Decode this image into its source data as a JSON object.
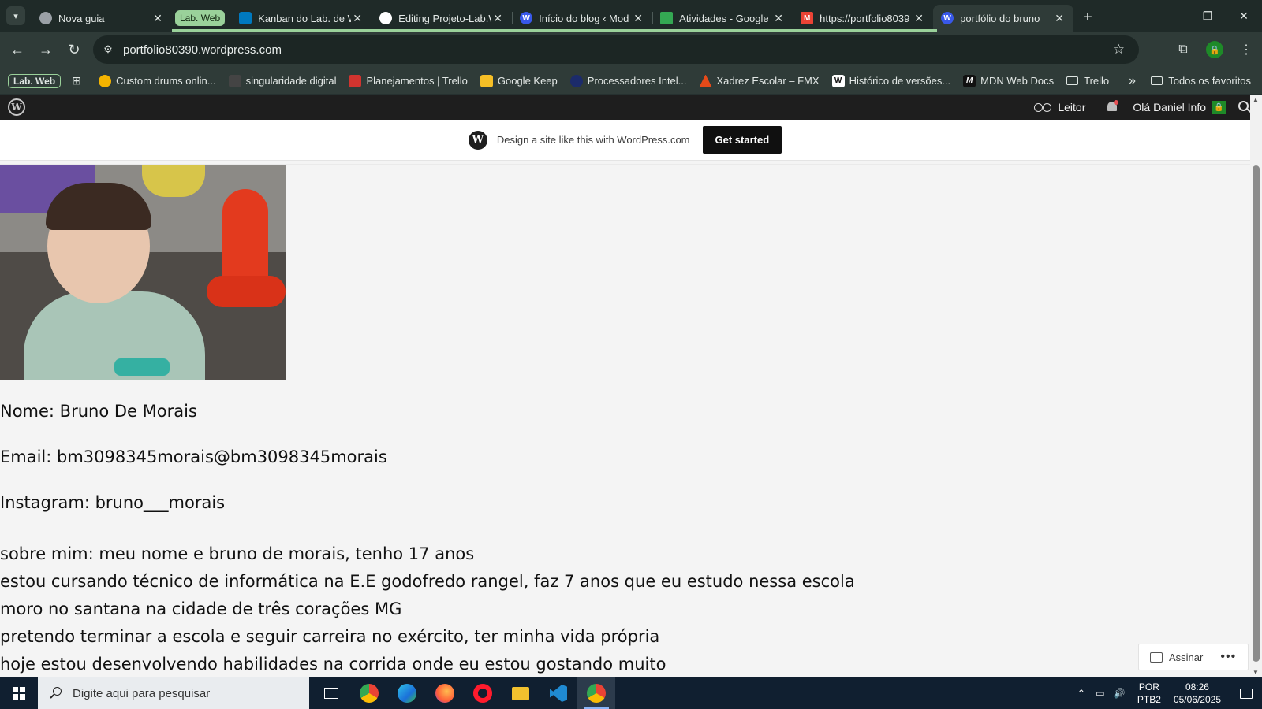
{
  "browser": {
    "tabs": [
      {
        "title": "Nova guia",
        "icon": "chrome-icon",
        "color": "#9aa0a6"
      },
      {
        "title": "Kanban do Lab. de W",
        "icon": "trello-icon",
        "color": "#0079bf"
      },
      {
        "title": "Editing Projeto-Lab.W",
        "icon": "github-icon",
        "color": "#ffffff"
      },
      {
        "title": "Início do blog ‹ Mod",
        "icon": "wordpress-icon",
        "color": "#3858e9"
      },
      {
        "title": "Atividades - Google",
        "icon": "google-drive-icon",
        "color": "#34a853"
      },
      {
        "title": "https://portfolio8039",
        "icon": "gmail-icon",
        "color": "#ea4335"
      },
      {
        "title": "portfólio do bruno",
        "icon": "wordpress-icon",
        "color": "#3858e9",
        "active": true
      }
    ],
    "tab_group_label": "Lab. Web",
    "address": "portfolio80390.wordpress.com",
    "bookmarks_group": "Lab. Web",
    "bookmarks": [
      {
        "label": "Custom drums onlin...",
        "color": "#f5b400"
      },
      {
        "label": "singularidade digital",
        "color": "#444444"
      },
      {
        "label": "Planejamentos | Trello",
        "color": "#d1342f"
      },
      {
        "label": "Google Keep",
        "color": "#f6bf26"
      },
      {
        "label": "Processadores Intel...",
        "color": "#1c2b6b"
      },
      {
        "label": "Xadrez Escolar – FMX",
        "color": "#e64a19"
      },
      {
        "label": "Histórico de versões...",
        "color": "#ffffff"
      },
      {
        "label": "MDN Web Docs",
        "color": "#111111"
      },
      {
        "label": "Trello",
        "color": "folder"
      }
    ],
    "all_bookmarks": "Todos os favoritos",
    "profile_initial": "🔒"
  },
  "wp_admin": {
    "reader": "Leitor",
    "greeting": "Olá Daniel Info"
  },
  "promo": {
    "text": "Design a site like this with WordPress.com",
    "button": "Get started"
  },
  "profile": {
    "name_line": "Nome: Bruno De Morais",
    "email_line": "Email: bm3098345morais@bm3098345morais",
    "instagram_line": "Instagram: bruno___morais",
    "about": [
      "sobre mim: meu nome e bruno de morais, tenho 17 anos",
      "estou cursando técnico de informática na E.E godofredo rangel, faz 7 anos que eu estudo nessa escola",
      "moro no santana na cidade de três corações MG",
      "pretendo terminar a escola e seguir carreira no exército, ter minha vida própria",
      "hoje estou desenvolvendo habilidades na corrida onde eu estou gostando muito"
    ]
  },
  "follow": {
    "label": "Assinar",
    "more": "•••"
  },
  "taskbar": {
    "search_placeholder": "Digite aqui para pesquisar",
    "lang_line1": "POR",
    "lang_line2": "PTB2",
    "time": "08:26",
    "date": "05/06/2025"
  }
}
